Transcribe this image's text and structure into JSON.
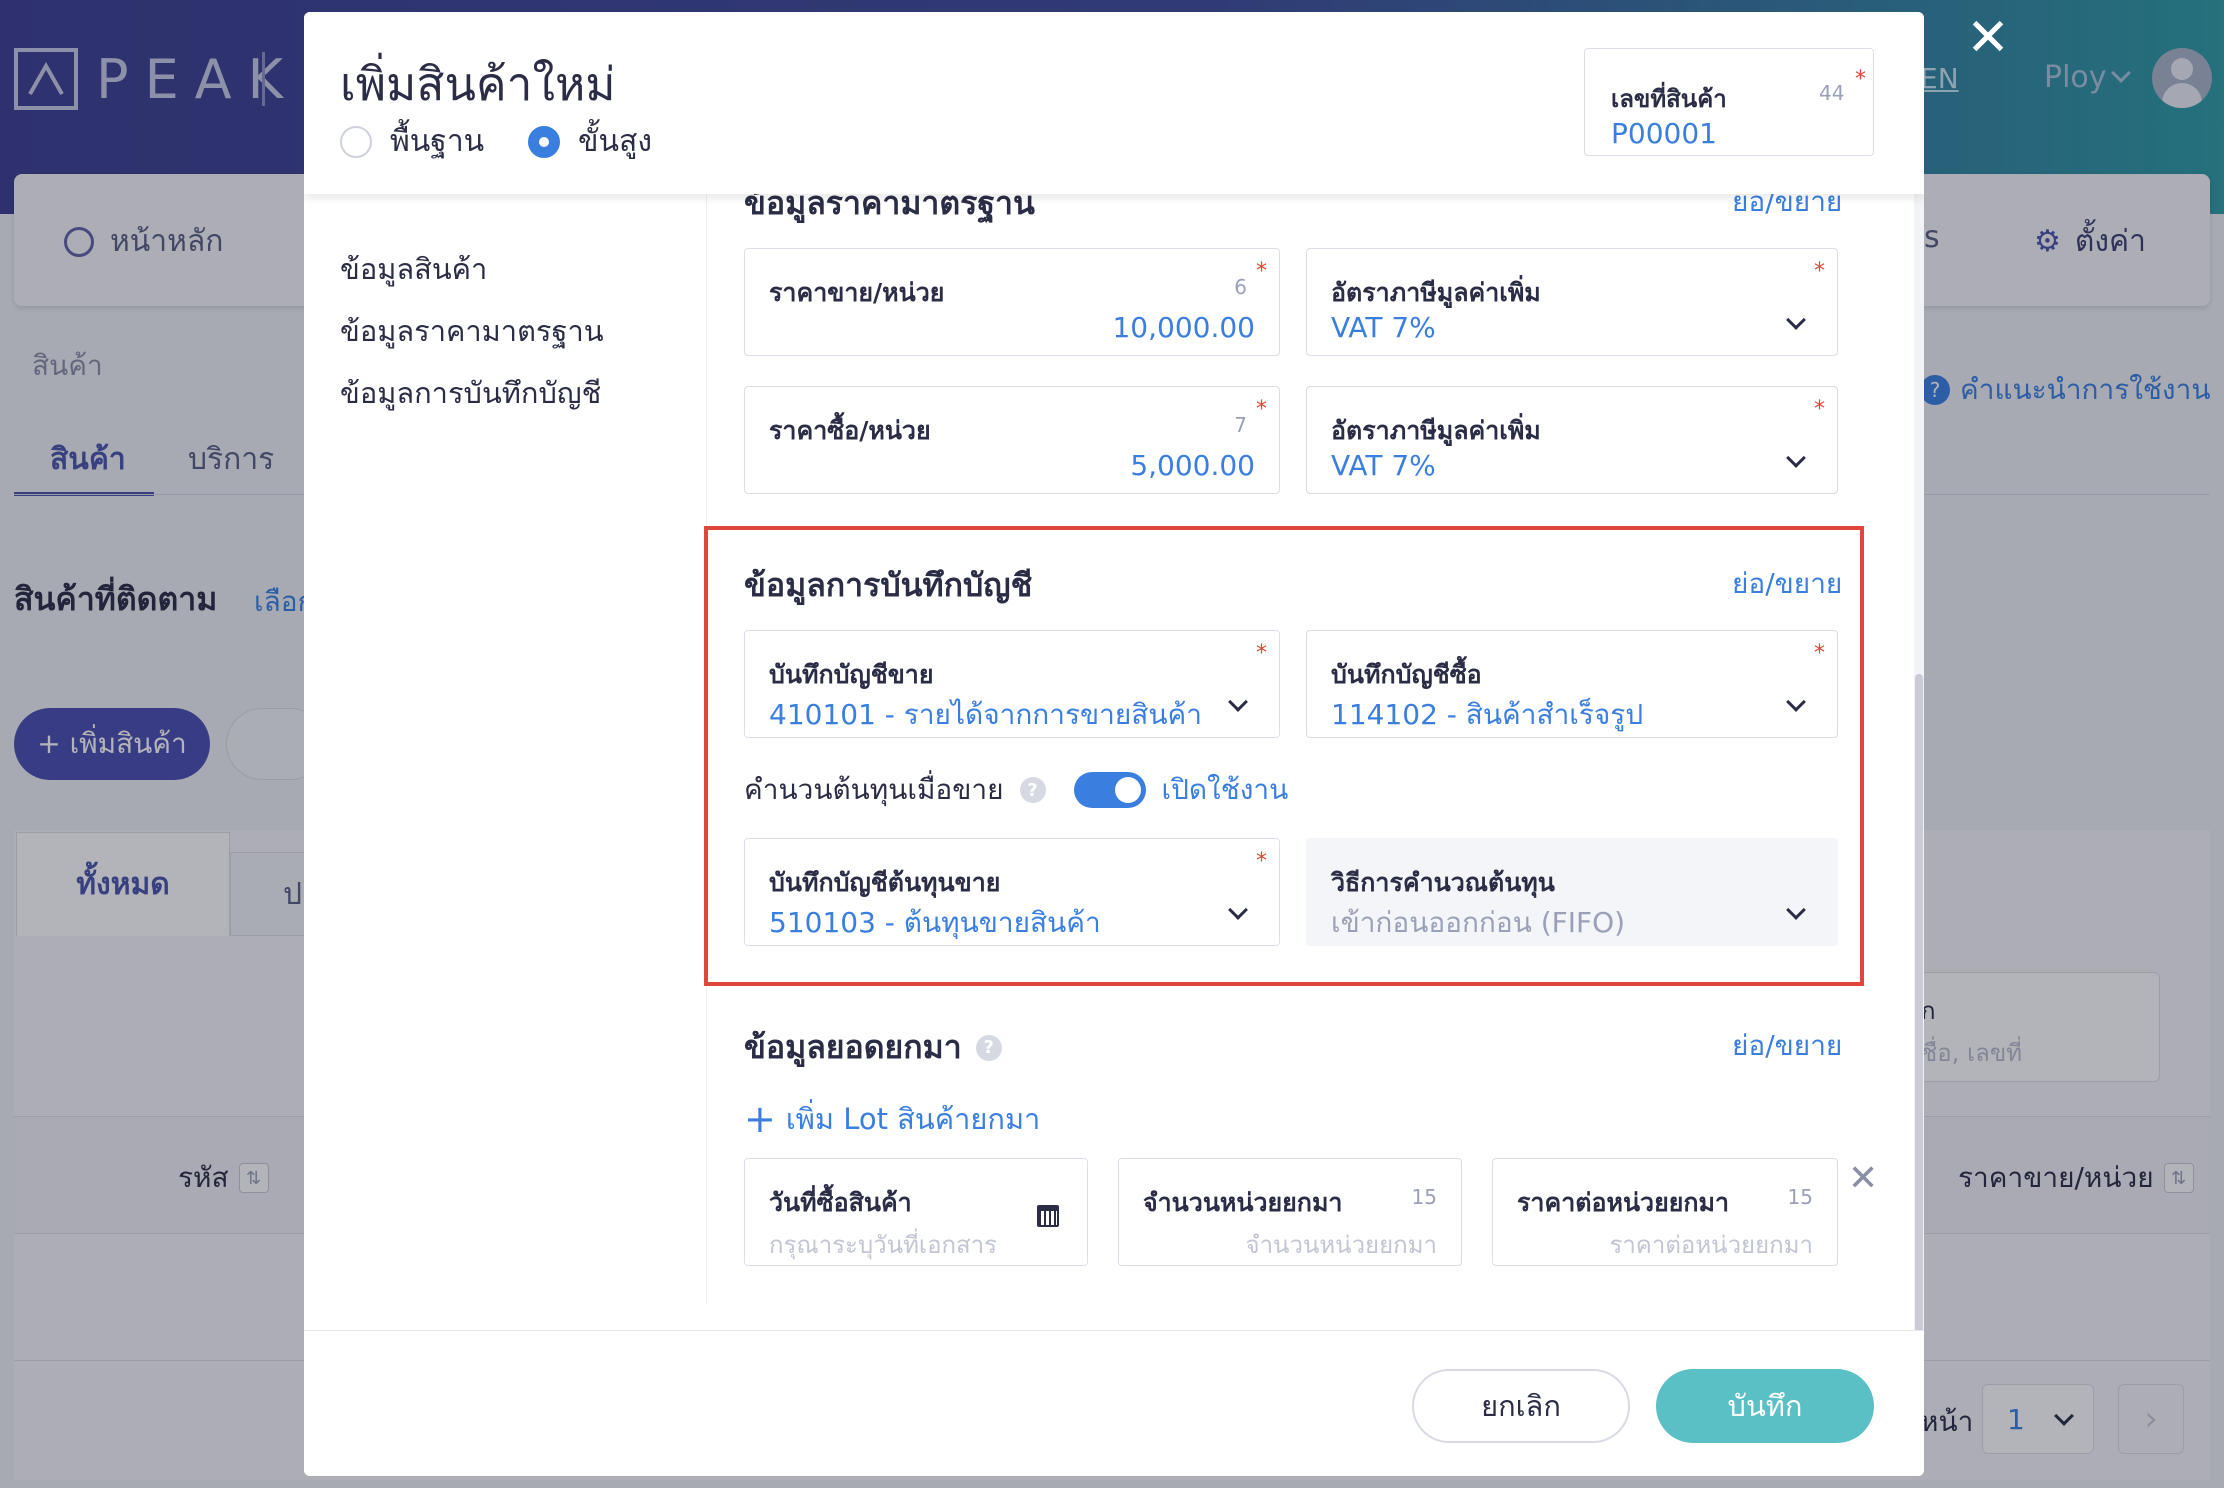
{
  "app": {
    "logo_text": "PEAK",
    "lang": "EN",
    "user": "Ploy",
    "nav": {
      "home": "หน้าหลัก",
      "partial_item": "s",
      "settings": "ตั้งค่า"
    },
    "breadcrumb": "สินค้า",
    "guide": "คำแนะนำการใช้งาน",
    "tabs": {
      "goods": "สินค้า",
      "service": "บริการ"
    },
    "tracked_title": "สินค้าที่ติดตาม",
    "tracked_select": "เลือก",
    "add_product": "+ เพิ่มสินค้า",
    "filter_tabs": {
      "all": "ทั้งหมด",
      "partial": "ป"
    },
    "search": {
      "label": "ก",
      "placeholder": "ชื่อ, เลขที่"
    },
    "table_headers": {
      "code": "รหัส",
      "price": "ราคาขาย/หน่วย"
    },
    "pagination": {
      "label": "หน้า",
      "page": "1"
    }
  },
  "modal": {
    "title": "เพิ่มสินค้าใหม่",
    "mode_options": {
      "basic": "พื้นฐาน",
      "advanced": "ขั้นสูง",
      "selected": "advanced"
    },
    "product_code": {
      "label": "เลขที่สินค้า",
      "count": "44",
      "value": "P00001"
    },
    "side_nav": [
      "ข้อมูลสินค้า",
      "ข้อมูลราคามาตรฐาน",
      "ข้อมูลการบันทึกบัญชี"
    ],
    "collapse_label": "ย่อ/ขยาย",
    "standard_price": {
      "title": "ข้อมูลราคามาตรฐาน",
      "sell_price": {
        "label": "ราคาขาย/หน่วย",
        "count": "6",
        "value": "10,000.00"
      },
      "sell_vat": {
        "label": "อัตราภาษีมูลค่าเพิ่ม",
        "value": "VAT 7%"
      },
      "buy_price": {
        "label": "ราคาซื้อ/หน่วย",
        "count": "7",
        "value": "5,000.00"
      },
      "buy_vat": {
        "label": "อัตราภาษีมูลค่าเพิ่ม",
        "value": "VAT 7%"
      }
    },
    "accounting": {
      "title": "ข้อมูลการบันทึกบัญชี",
      "sales_account": {
        "label": "บันทึกบัญชีขาย",
        "value": "410101 - รายได้จากการขายสินค้า"
      },
      "purchase_account": {
        "label": "บันทึกบัญชีซื้อ",
        "value": "114102 - สินค้าสำเร็จรูป"
      },
      "cost_calc": {
        "label": "คำนวนต้นทุนเมื่อขาย",
        "enabled": true,
        "status": "เปิดใช้งาน"
      },
      "cost_account": {
        "label": "บันทึกบัญชีต้นทุนขาย",
        "value": "510103 - ต้นทุนขายสินค้า"
      },
      "cost_method": {
        "label": "วิธีการคำนวณต้นทุน",
        "value": "เข้าก่อนออกก่อน (FIFO)"
      }
    },
    "opening_balance": {
      "title": "ข้อมูลยอดยกมา",
      "add_lot": "เพิ่ม Lot สินค้ายกมา",
      "purchase_date": {
        "label": "วันที่ซื้อสินค้า",
        "placeholder": "กรุณาระบุวันที่เอกสาร"
      },
      "qty": {
        "label": "จำนวนหน่วยยกมา",
        "count": "15",
        "placeholder": "จำนวนหน่วยยกมา"
      },
      "unit_price": {
        "label": "ราคาต่อหน่วยยกมา",
        "count": "15",
        "placeholder": "ราคาต่อหน่วยยกมา"
      }
    },
    "footer": {
      "cancel": "ยกเลิก",
      "save": "บันทึก"
    }
  },
  "colors": {
    "accent": "#3a7fe0",
    "highlight": "#e0463a",
    "save": "#5bbfc6",
    "brand": "#3b3f8f"
  }
}
